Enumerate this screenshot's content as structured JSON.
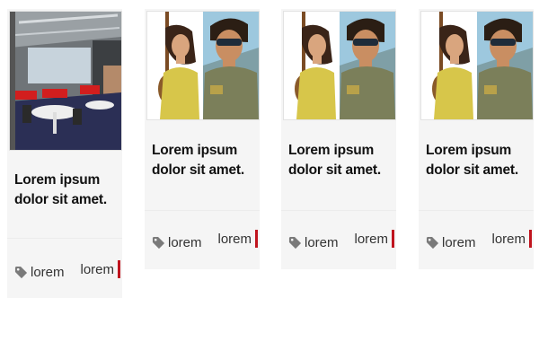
{
  "cards": [
    {
      "image": "office-photo",
      "title": "Lorem ipsum dolor sit amet.",
      "tag": "lorem",
      "author": "lorem"
    },
    {
      "image": "couple-photo",
      "title": "Lorem ipsum dolor sit amet.",
      "tag": "lorem",
      "author": "lorem"
    },
    {
      "image": "couple-photo",
      "title": "Lorem ipsum dolor sit amet.",
      "tag": "lorem",
      "author": "lorem"
    },
    {
      "image": "couple-photo",
      "title": "Lorem ipsum dolor sit amet.",
      "tag": "lorem",
      "author": "lorem"
    }
  ],
  "colors": {
    "accent": "#c0141e",
    "card_bg": "#f5f5f5",
    "text": "#111111"
  },
  "icons": {
    "tag": "tag-icon"
  }
}
